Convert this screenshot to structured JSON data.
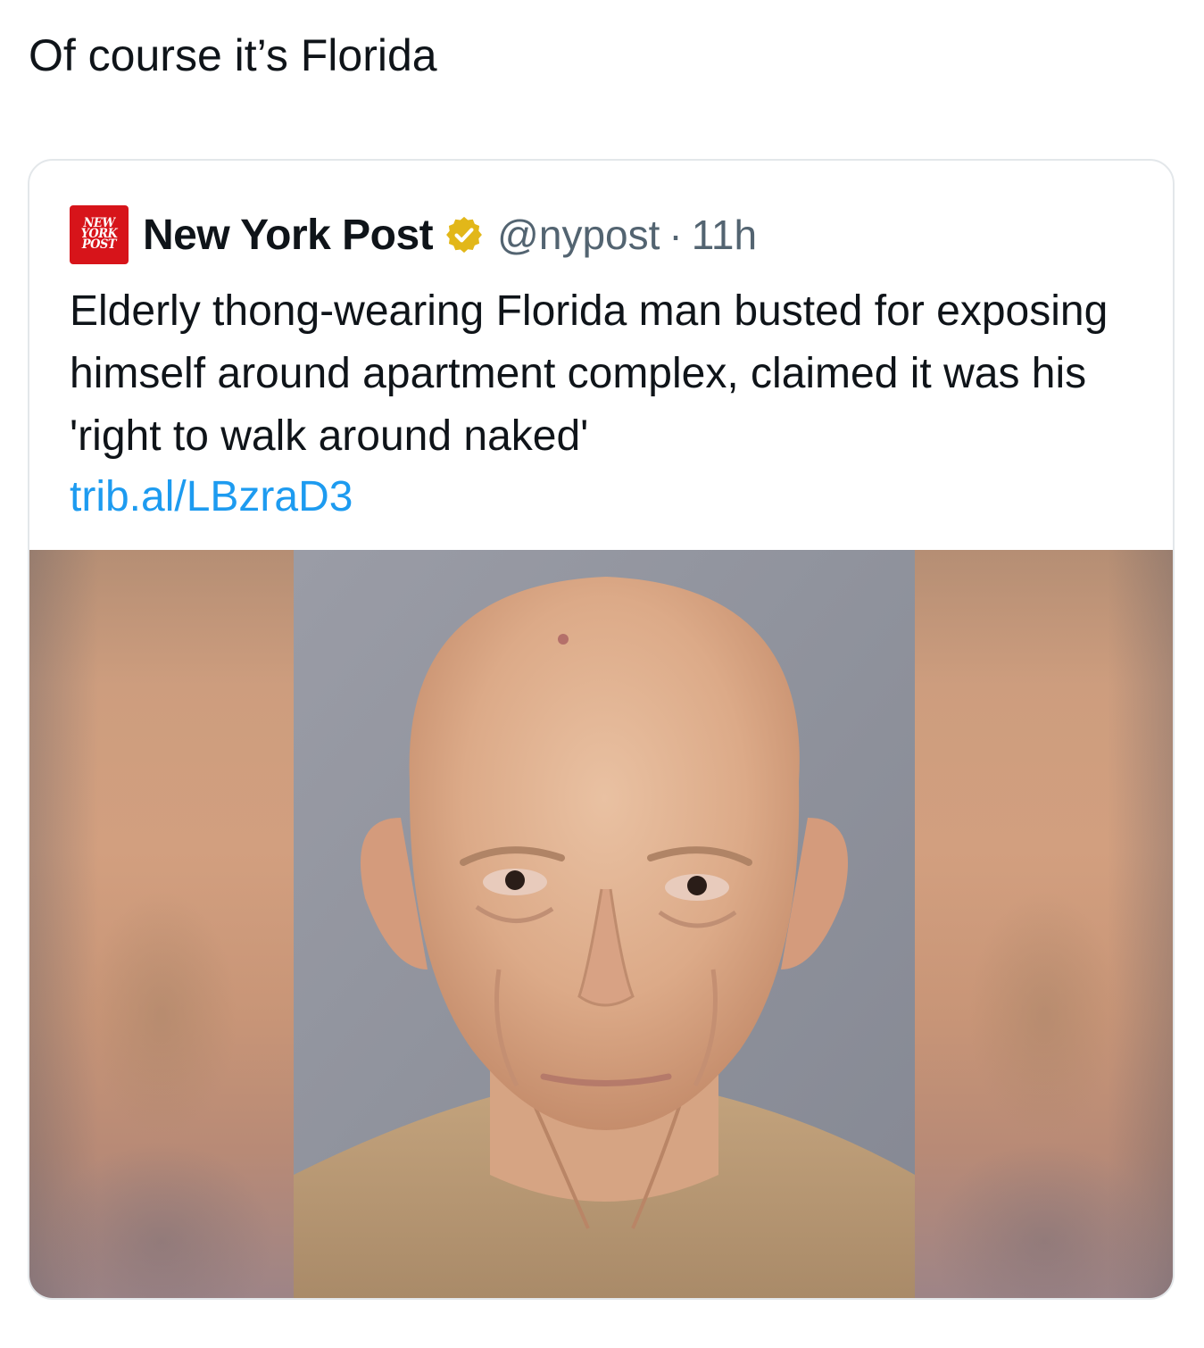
{
  "post": {
    "text": "Of course it’s Florida"
  },
  "quoted_tweet": {
    "logo_lines": [
      "NEW",
      "YORK",
      "POST"
    ],
    "display_name": "New York Post",
    "verified": true,
    "handle": "@nypost",
    "separator": "·",
    "time": "11h",
    "body": "Elderly thong-wearing Florida man busted for exposing himself around apartment complex, claimed it was his 'right to walk around naked'",
    "link": "trib.al/LBzraD3",
    "media": "mugshot-photo"
  },
  "colors": {
    "text": "#0f1419",
    "secondary": "#536471",
    "link": "#1d9bf0",
    "verified_gold": "#e2b719",
    "nyp_red": "#d7141a",
    "card_border": "#e3e7ea"
  }
}
